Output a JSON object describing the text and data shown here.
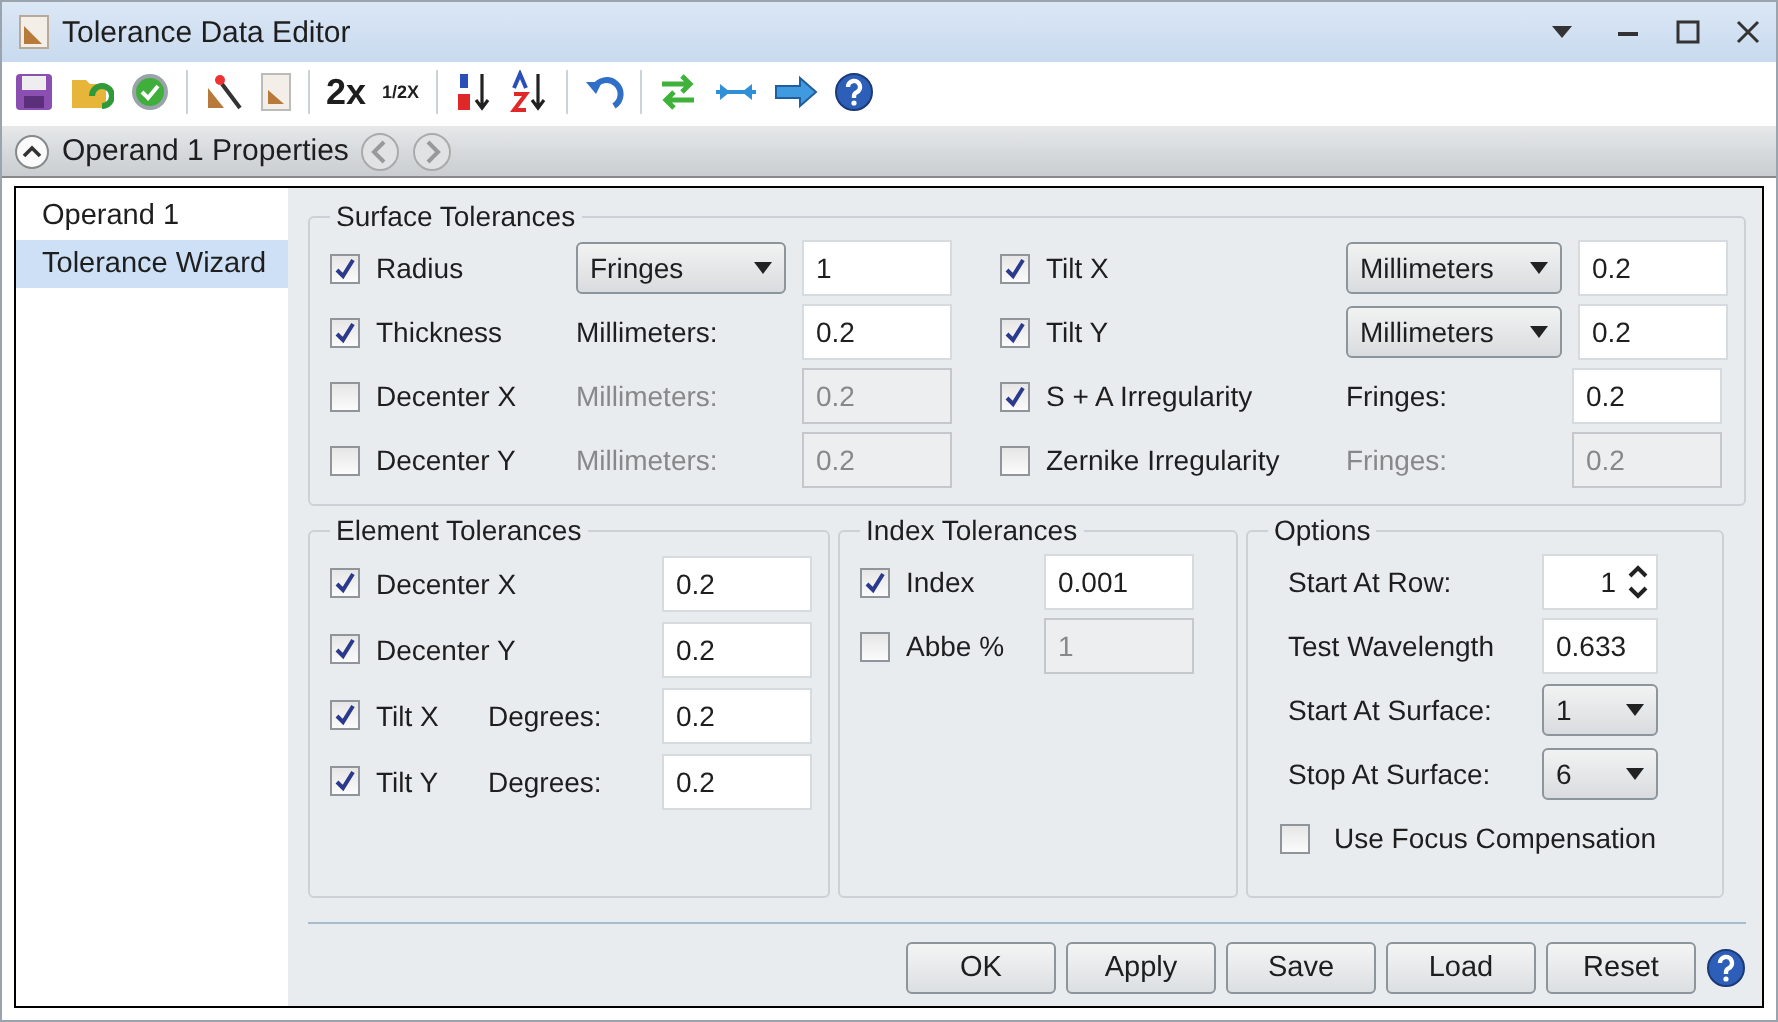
{
  "window": {
    "title": "Tolerance Data Editor"
  },
  "toolbar": {
    "zoom_in": "2x",
    "zoom_out": "1/2X"
  },
  "properties_bar": {
    "title": "Operand 1 Properties",
    "expanded": true
  },
  "sidebar": {
    "items": [
      {
        "label": "Operand 1",
        "selected": false
      },
      {
        "label": "Tolerance Wizard",
        "selected": true
      }
    ]
  },
  "surface_tolerances": {
    "title": "Surface Tolerances",
    "columns": [
      [
        {
          "label": "Radius",
          "checked": true,
          "kind": "dropdown",
          "unit": "Fringes",
          "value": "1"
        },
        {
          "label": "Thickness",
          "checked": true,
          "kind": "text",
          "unit": "Millimeters:",
          "value": "0.2"
        },
        {
          "label": "Decenter X",
          "checked": false,
          "kind": "text",
          "unit": "Millimeters:",
          "value": "0.2"
        },
        {
          "label": "Decenter Y",
          "checked": false,
          "kind": "text",
          "unit": "Millimeters:",
          "value": "0.2"
        }
      ],
      [
        {
          "label": "Tilt X",
          "checked": true,
          "kind": "dropdown",
          "unit": "Millimeters",
          "value": "0.2"
        },
        {
          "label": "Tilt Y",
          "checked": true,
          "kind": "dropdown",
          "unit": "Millimeters",
          "value": "0.2"
        },
        {
          "label": "S + A Irregularity",
          "checked": true,
          "kind": "text",
          "unit": "Fringes:",
          "value": "0.2"
        },
        {
          "label": "Zernike Irregularity",
          "checked": false,
          "kind": "text",
          "unit": "Fringes:",
          "value": "0.2"
        }
      ]
    ]
  },
  "element_tolerances": {
    "title": "Element Tolerances",
    "rows": [
      {
        "label": "Decenter X",
        "checked": true,
        "value": "0.2"
      },
      {
        "label": "Decenter Y",
        "checked": true,
        "value": "0.2"
      },
      {
        "label": "Tilt X",
        "checked": true,
        "unit": "Degrees:",
        "value": "0.2"
      },
      {
        "label": "Tilt Y",
        "checked": true,
        "unit": "Degrees:",
        "value": "0.2"
      }
    ]
  },
  "index_tolerances": {
    "title": "Index Tolerances",
    "rows": [
      {
        "label": "Index",
        "checked": true,
        "value": "0.001"
      },
      {
        "label": "Abbe %",
        "checked": false,
        "value": "1"
      }
    ]
  },
  "options": {
    "title": "Options",
    "rows": [
      {
        "kind": "spinner",
        "label": "Start At Row:",
        "value": "1"
      },
      {
        "kind": "input",
        "label": "Test Wavelength",
        "value": "0.633"
      },
      {
        "kind": "dropdown",
        "label": "Start At Surface:",
        "value": "1"
      },
      {
        "kind": "dropdown",
        "label": "Stop At Surface:",
        "value": "6"
      },
      {
        "kind": "checkbox",
        "label": "Use Focus Compensation",
        "checked": false
      }
    ]
  },
  "buttons": [
    "OK",
    "Apply",
    "Save",
    "Load",
    "Reset"
  ]
}
